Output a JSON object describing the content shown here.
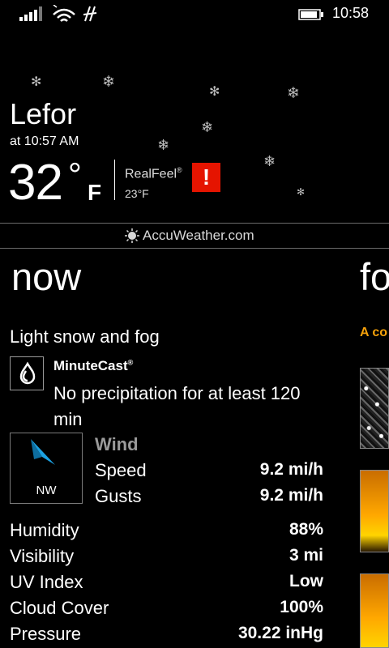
{
  "status": {
    "time": "10:58"
  },
  "location": {
    "city": "Lefor",
    "as_of": "at 10:57 AM"
  },
  "current": {
    "temp": "32",
    "deg": "°",
    "unit": "F",
    "realfeel_label": "RealFeel",
    "realfeel_reg": "®",
    "realfeel_value": "23°F",
    "alert_symbol": "!"
  },
  "brand": {
    "name": "AccuWeather.com"
  },
  "pivot": {
    "current": "now",
    "next": "fo"
  },
  "conditions": {
    "text": "Light snow and fog"
  },
  "minutecast": {
    "title": "MinuteCast",
    "reg": "®",
    "text": "No precipitation for at least 120 min"
  },
  "wind": {
    "title": "Wind",
    "direction": "NW",
    "rows": [
      {
        "label": "Speed",
        "value": "9.2 mi/h"
      },
      {
        "label": "Gusts",
        "value": "9.2 mi/h"
      }
    ]
  },
  "details": [
    {
      "label": "Humidity",
      "value": "88%"
    },
    {
      "label": "Visibility",
      "value": "3 mi"
    },
    {
      "label": "UV Index",
      "value": "Low"
    },
    {
      "label": "Cloud Cover",
      "value": "100%"
    },
    {
      "label": "Pressure",
      "value": "30.22 inHg"
    }
  ],
  "next_panel": {
    "teaser": "A co"
  },
  "icons": {
    "signal": "signal-strength-icon",
    "wifi": "wifi-icon",
    "nfc": "nfc-icon",
    "battery": "battery-icon",
    "alert": "alert-icon",
    "minutecast": "raindrop-icon",
    "wind": "wind-arrow-icon",
    "snowflake": "snowflake-icon",
    "brand_sun": "accuweather-sun-icon"
  },
  "colors": {
    "alert": "#e51400",
    "accent": "#f5a10a",
    "wind_arrow": "#1ba1e2"
  }
}
